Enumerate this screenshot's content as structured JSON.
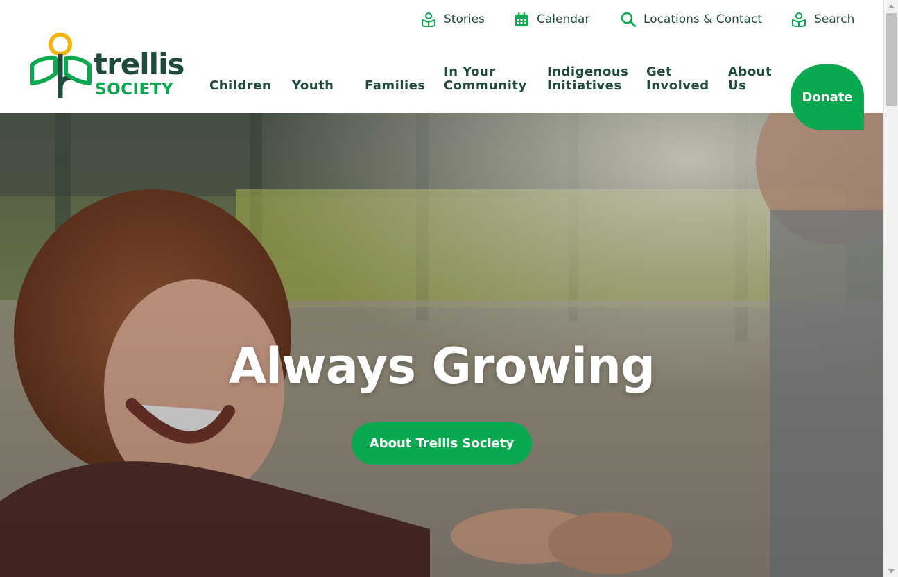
{
  "utility_nav": [
    {
      "label": "Stories",
      "icon": "book-reader-icon"
    },
    {
      "label": "Calendar",
      "icon": "calendar-icon"
    },
    {
      "label": "Locations & Contact",
      "icon": "search-icon"
    },
    {
      "label": "Search",
      "icon": "book-reader-icon"
    }
  ],
  "logo": {
    "line1": "trellis",
    "line2": "SOCIETY"
  },
  "main_nav": [
    {
      "lines": [
        "Children"
      ]
    },
    {
      "lines": [
        "Youth"
      ]
    },
    {
      "lines": [
        "Families"
      ]
    },
    {
      "lines": [
        "In Your",
        "Community"
      ]
    },
    {
      "lines": [
        "Indigenous",
        "Initiatives"
      ]
    },
    {
      "lines": [
        "Get",
        "Involved"
      ]
    },
    {
      "lines": [
        "About",
        "Us"
      ]
    }
  ],
  "donate_label": "Donate",
  "hero": {
    "heading": "Always Growing",
    "button_label": "About Trellis Society"
  },
  "colors": {
    "brand_green": "#0aa84f",
    "dark_green": "#1f4a3c",
    "logo_yellow": "#f2b50d"
  }
}
